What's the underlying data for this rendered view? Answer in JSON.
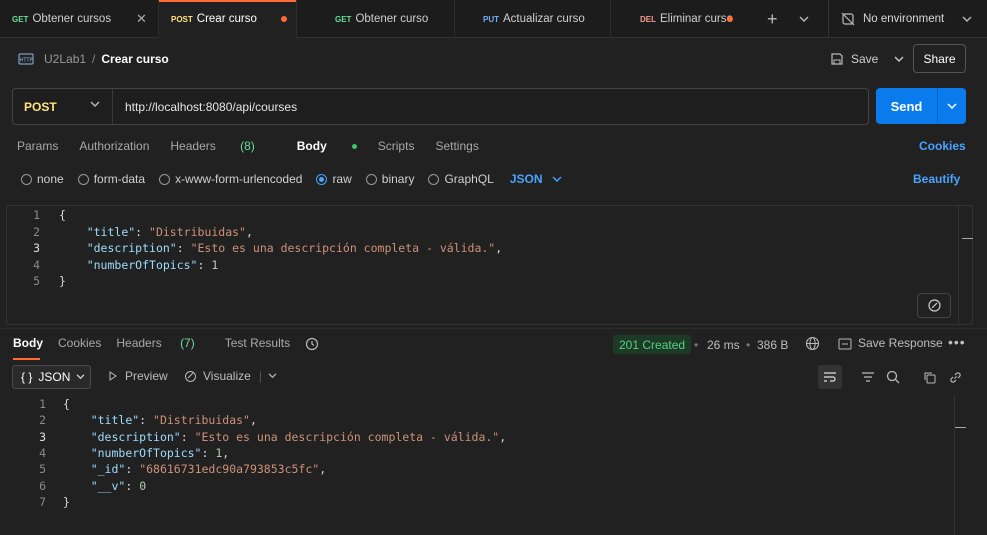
{
  "tabs": [
    {
      "method": "GET",
      "label": "Obtener cursos",
      "state": "close"
    },
    {
      "method": "POST",
      "label": "Crear curso",
      "state": "unsaved",
      "active": true
    },
    {
      "method": "GET",
      "label": "Obtener curso",
      "state": ""
    },
    {
      "method": "PUT",
      "label": "Actualizar curso",
      "state": ""
    },
    {
      "method": "DEL",
      "label": "Eliminar curso",
      "state": "unsaved"
    }
  ],
  "environment": {
    "label": "No environment"
  },
  "header": {
    "project": "U2Lab1",
    "separator": "/",
    "request_name": "Crear curso",
    "save_label": "Save",
    "share_label": "Share"
  },
  "request": {
    "method": "POST",
    "url": "http://localhost:8080/api/courses",
    "send_label": "Send"
  },
  "req_tabs": {
    "params": "Params",
    "authorization": "Authorization",
    "headers": "Headers",
    "headers_count": "(8)",
    "body": "Body",
    "scripts": "Scripts",
    "settings": "Settings",
    "cookies": "Cookies"
  },
  "body_types": {
    "none": "none",
    "form_data": "form-data",
    "urlencoded": "x-www-form-urlencoded",
    "raw": "raw",
    "binary": "binary",
    "graphql": "GraphQL",
    "format": "JSON",
    "beautify": "Beautify"
  },
  "request_body": [
    {
      "n": "1",
      "parts": [
        [
          "p",
          "{"
        ]
      ]
    },
    {
      "n": "2",
      "parts": [
        [
          "p",
          "    "
        ],
        [
          "k",
          "\"title\""
        ],
        [
          "p",
          ": "
        ],
        [
          "s",
          "\"Distribuidas\""
        ],
        [
          "p",
          ","
        ]
      ]
    },
    {
      "n": "3",
      "parts": [
        [
          "p",
          "    "
        ],
        [
          "k",
          "\"description\""
        ],
        [
          "p",
          ": "
        ],
        [
          "s",
          "\"Esto es una descripción completa - válida.\""
        ],
        [
          "p",
          ","
        ]
      ]
    },
    {
      "n": "4",
      "parts": [
        [
          "p",
          "    "
        ],
        [
          "k",
          "\"numberOfTopics\""
        ],
        [
          "p",
          ": "
        ],
        [
          "n",
          "1"
        ]
      ]
    },
    {
      "n": "5",
      "parts": [
        [
          "p",
          "}"
        ]
      ]
    }
  ],
  "response": {
    "tabs": {
      "body": "Body",
      "cookies": "Cookies",
      "headers": "Headers",
      "headers_count": "(7)",
      "test_results": "Test Results"
    },
    "status": "201 Created",
    "time": "26 ms",
    "size": "386 B",
    "save_label": "Save Response",
    "format": "JSON",
    "preview": "Preview",
    "visualize": "Visualize",
    "lines": [
      {
        "n": "1",
        "parts": [
          [
            "p",
            "{"
          ]
        ]
      },
      {
        "n": "2",
        "parts": [
          [
            "p",
            "    "
          ],
          [
            "k",
            "\"title\""
          ],
          [
            "p",
            ": "
          ],
          [
            "s",
            "\"Distribuidas\""
          ],
          [
            "p",
            ","
          ]
        ]
      },
      {
        "n": "3",
        "parts": [
          [
            "p",
            "    "
          ],
          [
            "k",
            "\"description\""
          ],
          [
            "p",
            ": "
          ],
          [
            "s",
            "\"Esto es una descripción completa - válida.\""
          ],
          [
            "p",
            ","
          ]
        ]
      },
      {
        "n": "4",
        "parts": [
          [
            "p",
            "    "
          ],
          [
            "k",
            "\"numberOfTopics\""
          ],
          [
            "p",
            ": "
          ],
          [
            "n",
            "1"
          ],
          [
            "p",
            ","
          ]
        ]
      },
      {
        "n": "5",
        "parts": [
          [
            "p",
            "    "
          ],
          [
            "k",
            "\"_id\""
          ],
          [
            "p",
            ": "
          ],
          [
            "s",
            "\"68616731edc90a793853c5fc\""
          ],
          [
            "p",
            ","
          ]
        ]
      },
      {
        "n": "6",
        "parts": [
          [
            "p",
            "    "
          ],
          [
            "k",
            "\"__v\""
          ],
          [
            "p",
            ": "
          ],
          [
            "n",
            "0"
          ]
        ]
      },
      {
        "n": "7",
        "parts": [
          [
            "p",
            "}"
          ]
        ]
      }
    ]
  },
  "colors": {
    "accent": "#ff6c37",
    "send": "#097bed",
    "link": "#4aa3ff",
    "status_ok": "#55d184"
  }
}
